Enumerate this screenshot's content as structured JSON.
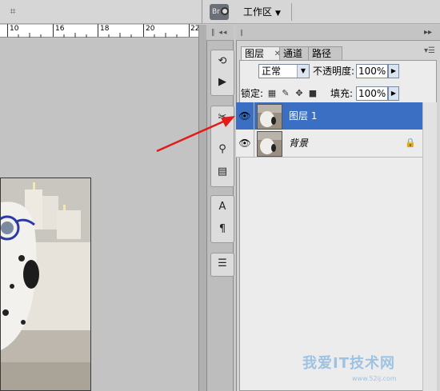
{
  "toolbar": {
    "workspace_label": "工作区",
    "bridge_label": "Br"
  },
  "ruler": {
    "labels": [
      "10",
      "16",
      "18",
      "20",
      "22"
    ]
  },
  "panel": {
    "tabs": [
      {
        "label": "图层"
      },
      {
        "label": "通道"
      },
      {
        "label": "路径"
      }
    ],
    "blend_mode": "正常",
    "opacity_label": "不透明度:",
    "opacity_value": "100%",
    "lock_label": "锁定:",
    "fill_label": "填充:",
    "fill_value": "100%",
    "layers": [
      {
        "name": "图层 1",
        "selected": true,
        "visible": true
      },
      {
        "name": "背景",
        "selected": false,
        "visible": true,
        "locked": true
      }
    ]
  },
  "dock_tools": [
    {
      "icon": "history-brush-icon"
    },
    {
      "icon": "actions-play-icon"
    },
    {
      "icon": "tools-preset-icon"
    },
    {
      "icon": "clone-source-icon"
    },
    {
      "icon": "layer-comps-icon"
    },
    {
      "icon": "character-icon"
    },
    {
      "icon": "paragraph-icon"
    },
    {
      "icon": "notes-icon"
    }
  ],
  "annotation": {
    "color": "#e21b1b"
  },
  "watermark": {
    "text": "我爱IT技术网",
    "url": "www.52ij.com"
  },
  "colors": {
    "selected_layer": "#3a6fc4",
    "panel_bg": "#ececec"
  }
}
